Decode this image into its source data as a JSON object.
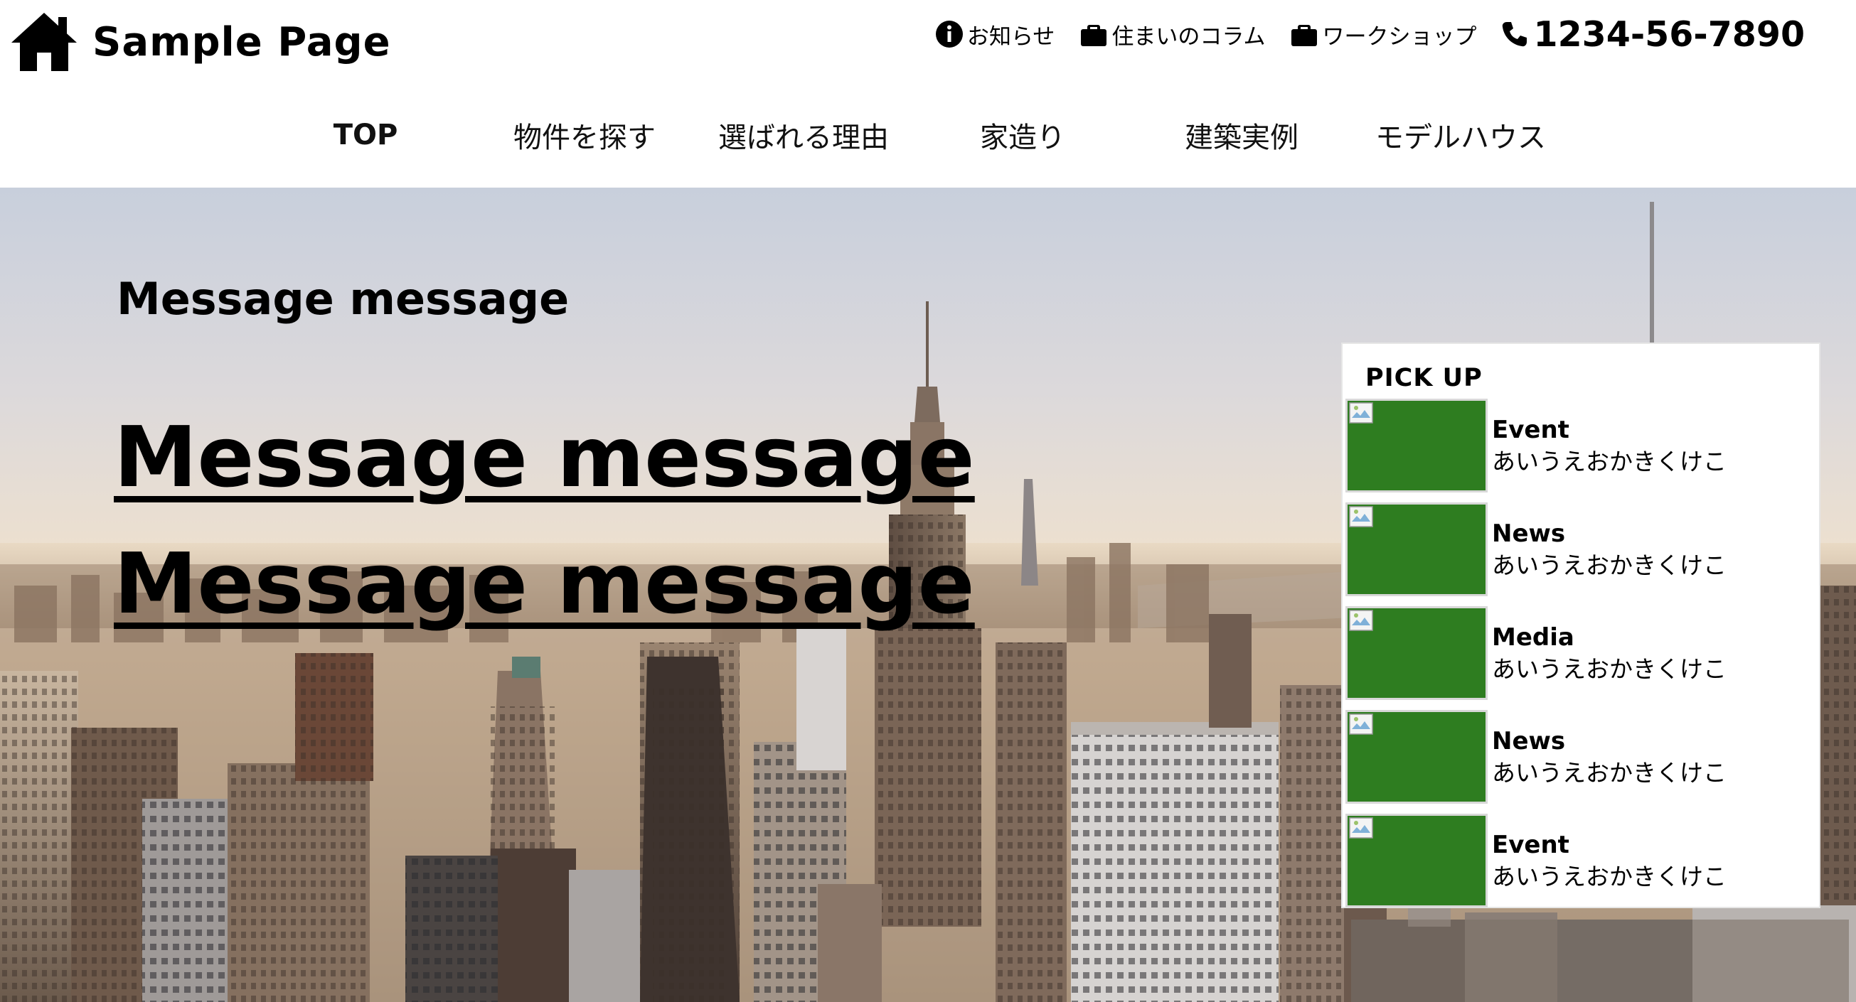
{
  "site": {
    "logo_text": "Sample Page"
  },
  "util_nav": [
    {
      "icon": "info-icon",
      "label": "お知らせ"
    },
    {
      "icon": "briefcase-icon",
      "label": "住まいのコラム"
    },
    {
      "icon": "briefcase-icon",
      "label": "ワークショップ"
    }
  ],
  "phone": {
    "icon": "phone-icon",
    "number": "1234-56-7890"
  },
  "global_nav": [
    {
      "label": "TOP",
      "active": true
    },
    {
      "label": "物件を探す"
    },
    {
      "label": "選ばれる理由"
    },
    {
      "label": "家造り"
    },
    {
      "label": "建築実例"
    },
    {
      "label": "モデルハウス"
    }
  ],
  "hero": {
    "subheading": "Message message",
    "headline_lines": [
      "Message message",
      "Message message"
    ]
  },
  "pickup": {
    "title": "PICK UP",
    "items": [
      {
        "category": "Event",
        "text": "あいうえおかきくけこ"
      },
      {
        "category": "News",
        "text": "あいうえおかきくけこ"
      },
      {
        "category": "Media",
        "text": "あいうえおかきくけこ"
      },
      {
        "category": "News",
        "text": "あいうえおかきくけこ"
      },
      {
        "category": "Event",
        "text": "あいうえおかきくけこ"
      }
    ]
  },
  "colors": {
    "thumb_placeholder": "#2e7d20",
    "header_bg": "#ffffff",
    "text": "#000000"
  }
}
